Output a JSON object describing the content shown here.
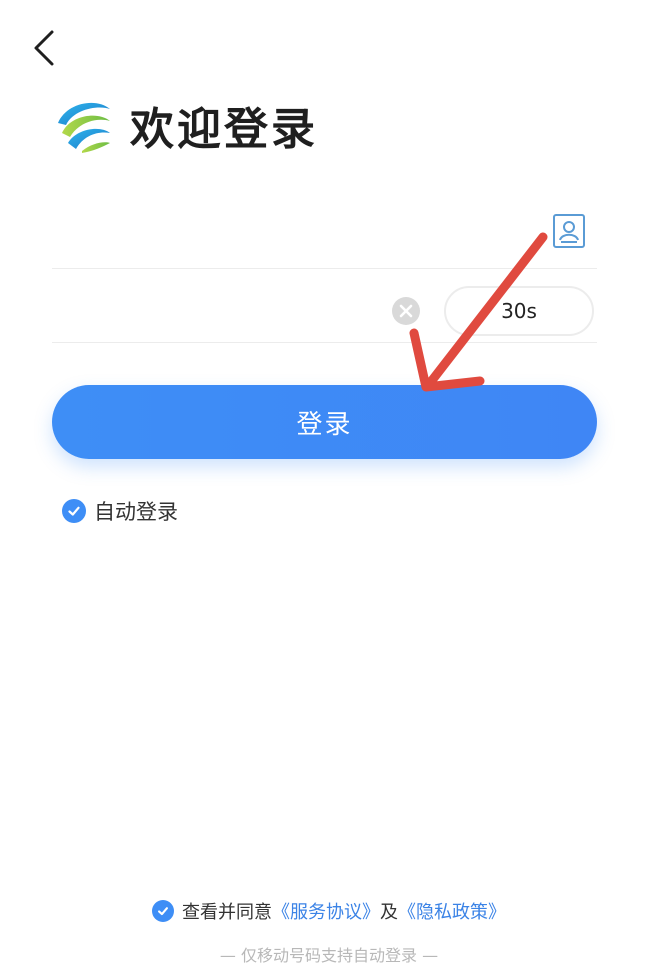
{
  "header": {
    "title": "欢迎登录",
    "logo_icon": "china-mobile-logo"
  },
  "form": {
    "phone": {
      "value": "",
      "placeholder": ""
    },
    "code": {
      "value": "",
      "placeholder": ""
    },
    "countdown_label": "30s",
    "login_label": "登录",
    "auto_login_label": "自动登录",
    "auto_login_checked": true
  },
  "agreement": {
    "prefix": "查看并同意",
    "service_link": "《服务协议》",
    "conjunction": "及",
    "privacy_link": "《隐私政策》",
    "checked": true
  },
  "footer": {
    "note": "— 仅移动号码支持自动登录 —"
  },
  "colors": {
    "accent": "#3e8ef6",
    "annotation": "#e04a3f"
  }
}
